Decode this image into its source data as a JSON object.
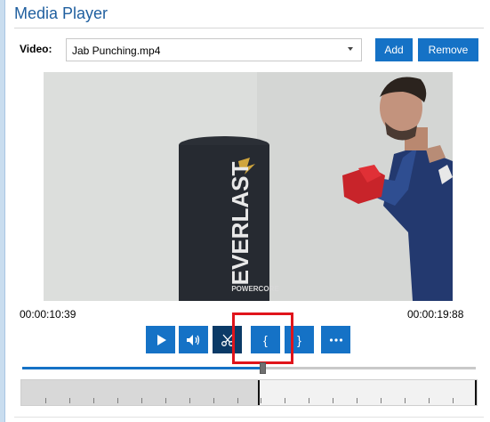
{
  "panel": {
    "title": "Media Player"
  },
  "video_row": {
    "label": "Video:",
    "selected_video": "Jab Punching.mp4",
    "add_label": "Add",
    "remove_label": "Remove"
  },
  "player": {
    "current_time": "00:00:10:39",
    "total_time": "00:00:19:88",
    "progress_fraction": 0.53,
    "timeline_position_fraction": 0.52,
    "controls": [
      {
        "name": "play-button",
        "icon": "play-icon"
      },
      {
        "name": "volume-button",
        "icon": "speaker-icon"
      },
      {
        "name": "cut-button",
        "icon": "scissors-icon"
      },
      {
        "name": "mark-in-button",
        "icon": "open-brace-icon"
      },
      {
        "name": "mark-out-button",
        "icon": "close-brace-icon"
      },
      {
        "name": "more-button",
        "icon": "more-icon"
      }
    ]
  },
  "video_frame": {
    "bag_brand": "EVERLAST",
    "bag_sub": "POWERCORE"
  },
  "colors": {
    "accent": "#1572c6",
    "accent_dark": "#0b3a67",
    "title": "#1f5f9f",
    "highlight": "#e0141b"
  }
}
